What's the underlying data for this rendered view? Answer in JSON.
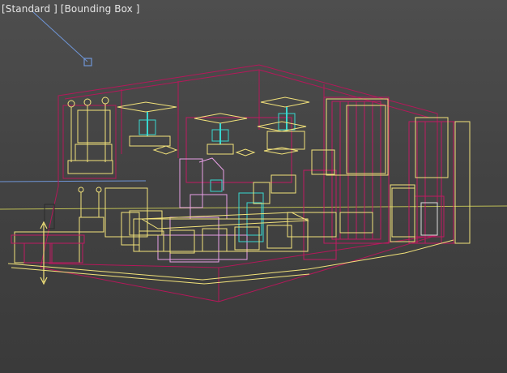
{
  "viewport": {
    "shading_label": "[Standard ]",
    "mode_label": "[Bounding Box ]"
  },
  "colors": {
    "background": "#444444",
    "horizon": "#c8c85a",
    "wire_yellow": "#f2e27a",
    "wire_magenta": "#b4185a",
    "wire_pink": "#e8a0e6",
    "wire_cyan": "#38d8d0",
    "light_target": "#6f95d6"
  },
  "icons": {
    "light": "target-light-icon",
    "move_gizmo": "move-arrow-icon"
  }
}
